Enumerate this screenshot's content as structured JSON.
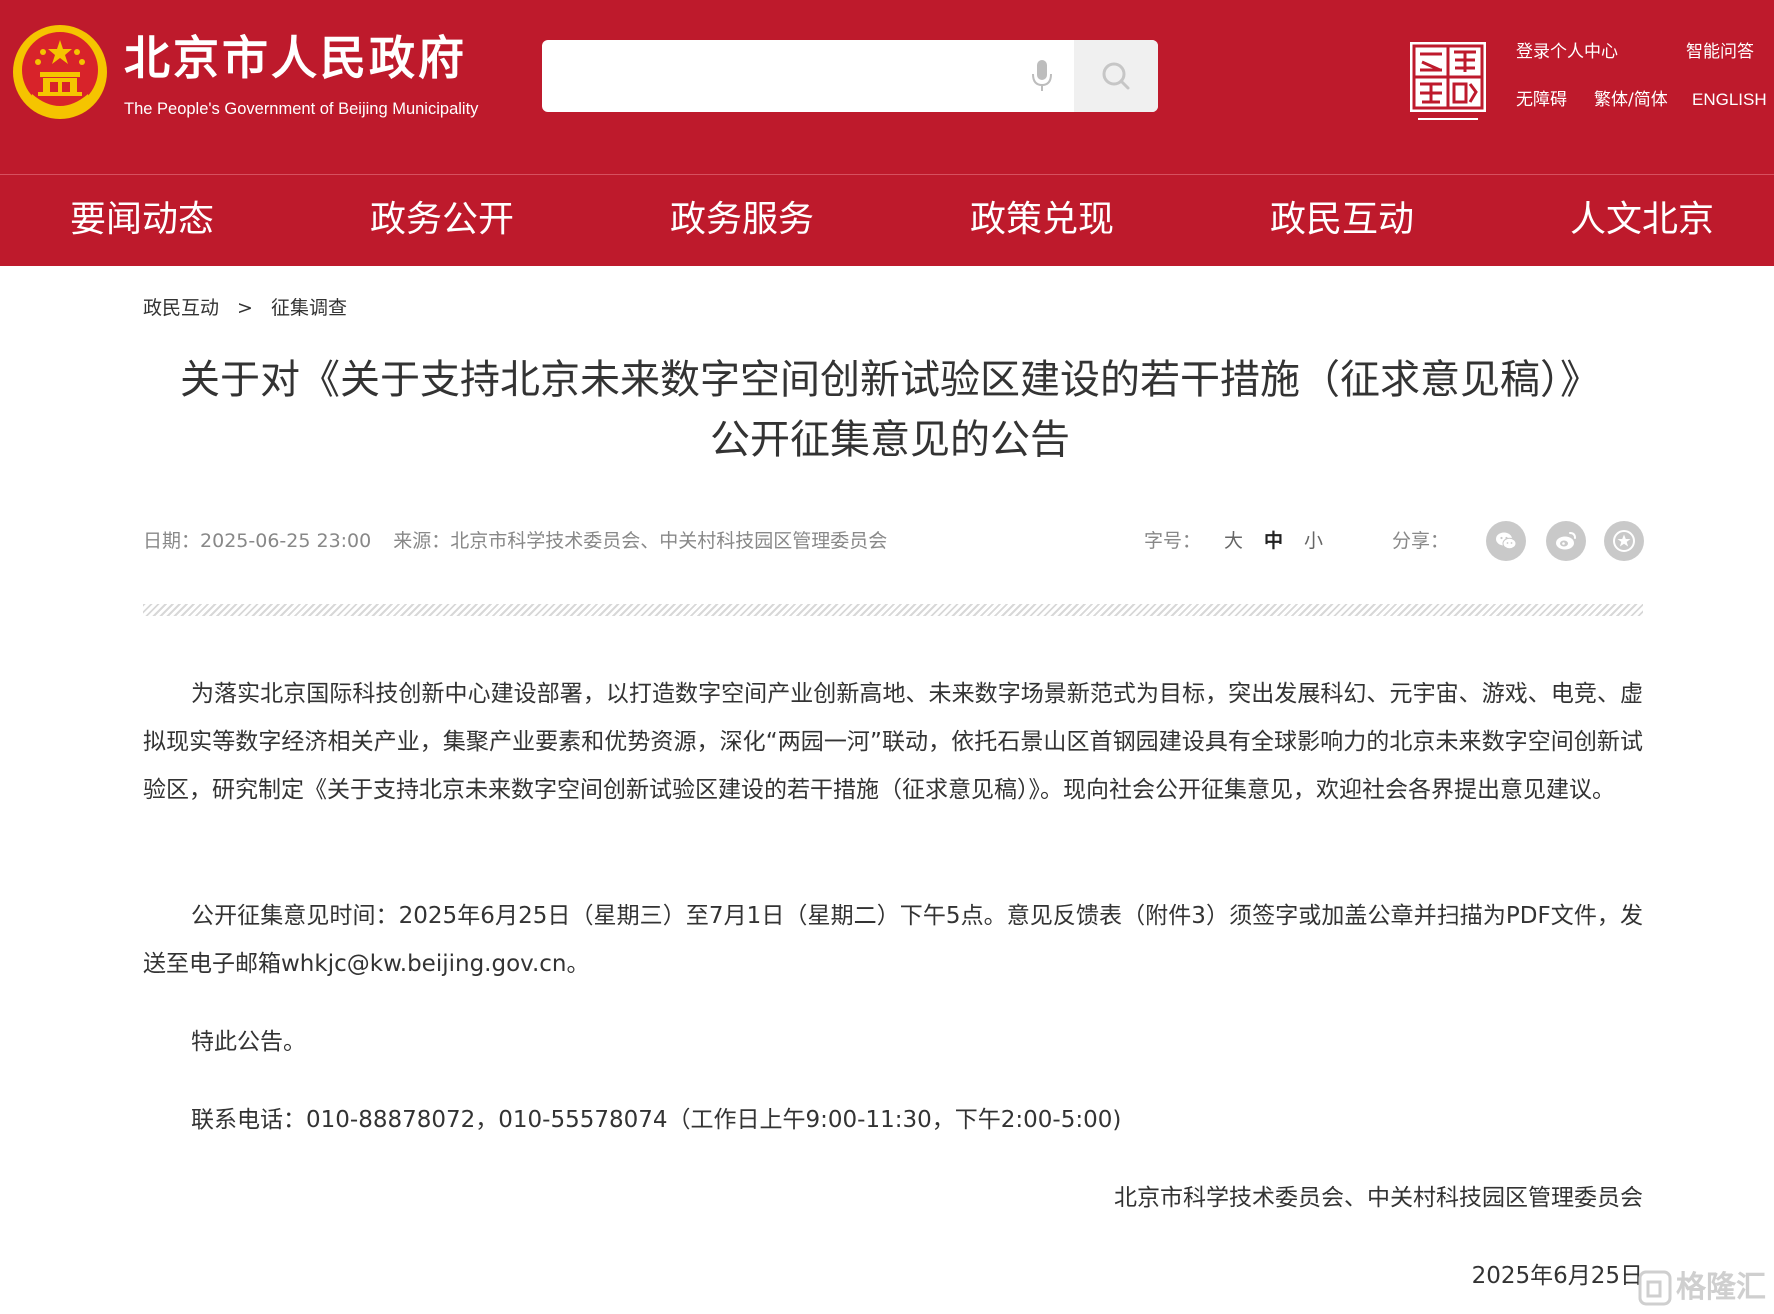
{
  "header": {
    "site_title": "北京市人民政府",
    "site_subtitle": "The People's Government of Beijing Municipality",
    "search_placeholder": "",
    "top_links": {
      "login": "登录个人中心",
      "ai_qa": "智能问答",
      "accessibility": "无障碍",
      "traditional_simplified": "繁体/简体",
      "english": "ENGLISH"
    },
    "colors": {
      "brand_red": "#be1a2c",
      "emblem_gold": "#f5c400"
    }
  },
  "nav": {
    "items": [
      "要闻动态",
      "政务公开",
      "政务服务",
      "政策兑现",
      "政民互动",
      "人文北京"
    ]
  },
  "breadcrumb": {
    "items": [
      "政民互动",
      "征集调查"
    ],
    "separator": ">"
  },
  "article": {
    "title": "关于对《关于支持北京未来数字空间创新试验区建设的若干措施（征求意见稿）》公开征集意见的公告",
    "meta": {
      "date_label": "日期：",
      "date": "2025-06-25 23:00",
      "source_label": "来源：",
      "source": "北京市科学技术委员会、中关村科技园区管理委员会"
    },
    "font_size": {
      "label": "字号：",
      "large": "大",
      "medium": "中",
      "small": "小",
      "selected": "中"
    },
    "share": {
      "label": "分享：",
      "icons": [
        "wechat-icon",
        "weibo-icon",
        "favorite-icon"
      ]
    },
    "paragraphs": [
      "为落实北京国际科技创新中心建设部署，以打造数字空间产业创新高地、未来数字场景新范式为目标，突出发展科幻、元宇宙、游戏、电竞、虚拟现实等数字经济相关产业，集聚产业要素和优势资源，深化“两园一河”联动，依托石景山区首钢园建设具有全球影响力的北京未来数字空间创新试验区，研究制定《关于支持北京未来数字空间创新试验区建设的若干措施（征求意见稿）》。现向社会公开征集意见，欢迎社会各界提出意见建议。",
      "公开征集意见时间：2025年6月25日（星期三）至7月1日（星期二）下午5点。意见反馈表（附件3）须签字或加盖公章并扫描为PDF文件，发送至电子邮箱whkjc@kw.beijing.gov.cn。",
      "特此公告。",
      "联系电话：010-88878072，010-55578074（工作日上午9:00-11:30，下午2:00-5:00)"
    ],
    "signature_org": "北京市科学技术委员会、中关村科技园区管理委员会",
    "signature_date": "2025年6月25日"
  },
  "watermark": {
    "text": "格隆汇"
  }
}
